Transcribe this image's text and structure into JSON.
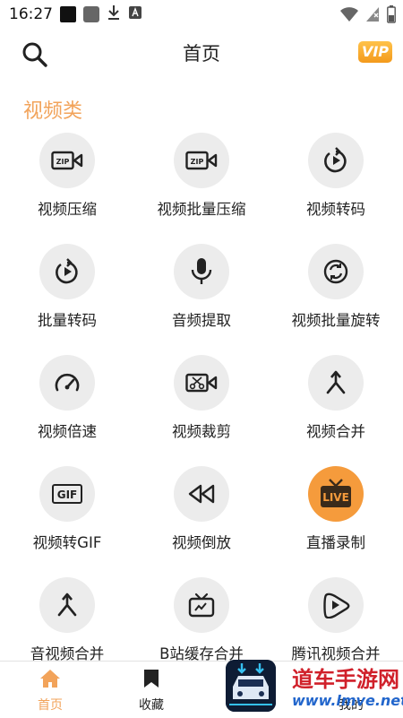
{
  "status_bar": {
    "time": "16:27"
  },
  "header": {
    "title": "首页",
    "vip_label": "VIP"
  },
  "section": {
    "title": "视频类"
  },
  "tools": [
    {
      "label": "视频压缩",
      "icon": "zip-video-icon"
    },
    {
      "label": "视频批量压缩",
      "icon": "zip-video-icon"
    },
    {
      "label": "视频转码",
      "icon": "rotate-play-icon"
    },
    {
      "label": "批量转码",
      "icon": "rotate-play-icon"
    },
    {
      "label": "音频提取",
      "icon": "microphone-icon"
    },
    {
      "label": "视频批量旋转",
      "icon": "rotate-icon"
    },
    {
      "label": "视频倍速",
      "icon": "speedometer-icon"
    },
    {
      "label": "视频裁剪",
      "icon": "scissors-video-icon"
    },
    {
      "label": "视频合并",
      "icon": "merge-icon"
    },
    {
      "label": "视频转GIF",
      "icon": "gif-icon",
      "badge": "GIF"
    },
    {
      "label": "视频倒放",
      "icon": "rewind-icon"
    },
    {
      "label": "直播录制",
      "icon": "live-tv-icon",
      "badge": "LIVE"
    },
    {
      "label": "音视频合并",
      "icon": "merge-icon"
    },
    {
      "label": "B站缓存合并",
      "icon": "tv-icon"
    },
    {
      "label": "腾讯视频合并",
      "icon": "tencent-video-icon"
    }
  ],
  "tabbar": {
    "home_label": "首页",
    "favorites_label": "收藏",
    "mine_label": "我的"
  },
  "watermark": {
    "line1": "道车手游网",
    "line2": "www.lmve.net"
  },
  "colors": {
    "accent": "#f2a35a",
    "live_bg": "#f59b3c",
    "circle_bg": "#ececec"
  }
}
